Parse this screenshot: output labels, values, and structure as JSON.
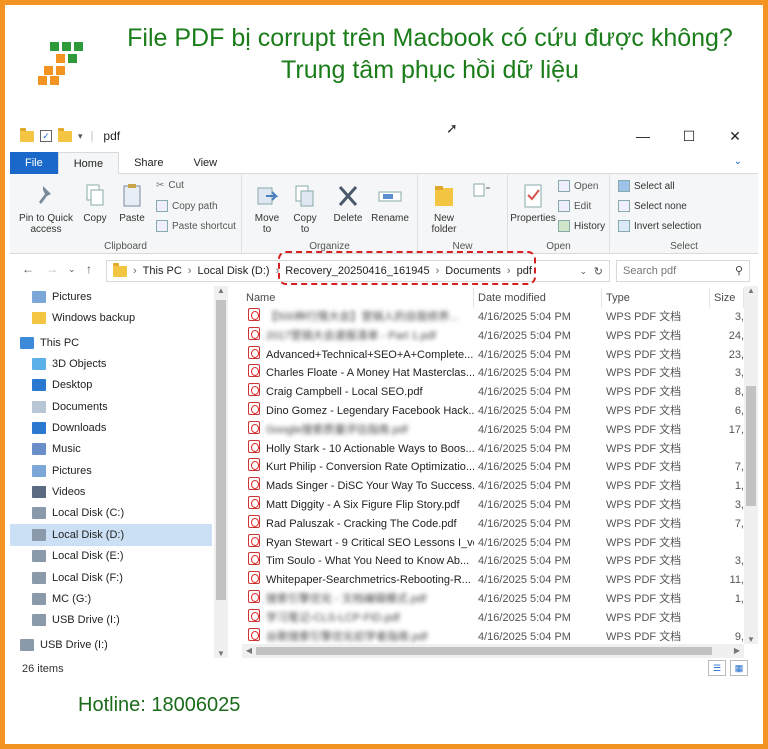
{
  "header": {
    "title": "File PDF bị corrupt trên Macbook có cứu được không? Trung tâm phục hồi dữ liệu",
    "hotline": "Hotline: 18006025"
  },
  "window": {
    "title": "pdf",
    "tabs": [
      "File",
      "Home",
      "Share",
      "View"
    ],
    "active_tab": "Home"
  },
  "ribbon": {
    "clipboard": {
      "group": "Clipboard",
      "pin": "Pin to Quick access",
      "copy": "Copy",
      "paste": "Paste",
      "cut": "Cut",
      "copy_path": "Copy path",
      "paste_shortcut": "Paste shortcut"
    },
    "organize": {
      "group": "Organize",
      "move_to": "Move to",
      "copy_to": "Copy to",
      "delete": "Delete",
      "rename": "Rename"
    },
    "new": {
      "group": "New",
      "new_folder": "New folder"
    },
    "open": {
      "group": "Open",
      "properties": "Properties",
      "open": "Open",
      "edit": "Edit",
      "history": "History"
    },
    "select": {
      "group": "Select",
      "select_all": "Select all",
      "select_none": "Select none",
      "invert": "Invert selection"
    }
  },
  "address": {
    "crumbs": [
      "This PC",
      "Local Disk (D:)",
      "Recovery_20250416_161945",
      "Documents",
      "pdf"
    ],
    "search_placeholder": "Search pdf"
  },
  "nav": [
    {
      "label": "Pictures",
      "icon": "pictures-icon"
    },
    {
      "label": "Windows backup",
      "icon": "folder-icon"
    },
    {
      "label": "This PC",
      "icon": "pc-icon"
    },
    {
      "label": "3D Objects",
      "icon": "objects-icon"
    },
    {
      "label": "Desktop",
      "icon": "desktop-icon"
    },
    {
      "label": "Documents",
      "icon": "documents-icon"
    },
    {
      "label": "Downloads",
      "icon": "downloads-icon"
    },
    {
      "label": "Music",
      "icon": "music-icon"
    },
    {
      "label": "Pictures",
      "icon": "pictures-icon"
    },
    {
      "label": "Videos",
      "icon": "videos-icon"
    },
    {
      "label": "Local Disk (C:)",
      "icon": "drive-icon"
    },
    {
      "label": "Local Disk (D:)",
      "icon": "drive-icon",
      "selected": true
    },
    {
      "label": "Local Disk (E:)",
      "icon": "drive-icon"
    },
    {
      "label": "Local Disk (F:)",
      "icon": "drive-icon"
    },
    {
      "label": "MC (G:)",
      "icon": "drive-icon"
    },
    {
      "label": "USB Drive (I:)",
      "icon": "drive-icon"
    },
    {
      "label": "USB Drive (I:)",
      "icon": "drive-icon"
    }
  ],
  "columns": [
    "Name",
    "Date modified",
    "Type",
    "Size"
  ],
  "files": [
    {
      "name": "【500种行情大会】营销人的自我修养...",
      "blur": true,
      "date": "4/16/2025 5:04 PM",
      "type": "WPS PDF 文档",
      "size": "3,"
    },
    {
      "name": "2017营销大会速报清单 - Part 1.pdf",
      "blur": true,
      "date": "4/16/2025 5:04 PM",
      "type": "WPS PDF 文档",
      "size": "24,"
    },
    {
      "name": "Advanced+Technical+SEO+A+Complete...",
      "date": "4/16/2025 5:04 PM",
      "type": "WPS PDF 文档",
      "size": "23,"
    },
    {
      "name": "Charles Floate - A Money Hat Masterclas...",
      "date": "4/16/2025 5:04 PM",
      "type": "WPS PDF 文档",
      "size": "3,"
    },
    {
      "name": "Craig Campbell - Local SEO.pdf",
      "date": "4/16/2025 5:04 PM",
      "type": "WPS PDF 文档",
      "size": "8,"
    },
    {
      "name": "Dino Gomez - Legendary Facebook Hack...",
      "date": "4/16/2025 5:04 PM",
      "type": "WPS PDF 文档",
      "size": "6,"
    },
    {
      "name": "Google搜索质量评估指南.pdf",
      "blur": true,
      "date": "4/16/2025 5:04 PM",
      "type": "WPS PDF 文档",
      "size": "17,"
    },
    {
      "name": "Holly Stark - 10 Actionable Ways to Boos...",
      "date": "4/16/2025 5:04 PM",
      "type": "WPS PDF 文档",
      "size": ""
    },
    {
      "name": "Kurt Philip - Conversion Rate Optimizatio...",
      "date": "4/16/2025 5:04 PM",
      "type": "WPS PDF 文档",
      "size": "7,"
    },
    {
      "name": "Mads Singer - DiSC Your Way To Success...",
      "date": "4/16/2025 5:04 PM",
      "type": "WPS PDF 文档",
      "size": "1,"
    },
    {
      "name": "Matt Diggity - A Six Figure Flip Story.pdf",
      "date": "4/16/2025 5:04 PM",
      "type": "WPS PDF 文档",
      "size": "3,"
    },
    {
      "name": "Rad Paluszak - Cracking The Code.pdf",
      "date": "4/16/2025 5:04 PM",
      "type": "WPS PDF 文档",
      "size": "7,"
    },
    {
      "name": "Ryan Stewart - 9 Critical SEO Lessons I_ve...",
      "date": "4/16/2025 5:04 PM",
      "type": "WPS PDF 文档",
      "size": ""
    },
    {
      "name": "Tim Soulo - What You Need to Know Ab...",
      "date": "4/16/2025 5:04 PM",
      "type": "WPS PDF 文档",
      "size": "3,"
    },
    {
      "name": "Whitepaper-Searchmetrics-Rebooting-R...",
      "date": "4/16/2025 5:04 PM",
      "type": "WPS PDF 文档",
      "size": "11,"
    },
    {
      "name": "搜索引擎优化 - 文档编辑模式.pdf",
      "blur": true,
      "date": "4/16/2025 5:04 PM",
      "type": "WPS PDF 文档",
      "size": "1,"
    },
    {
      "name": "学习笔记-CLS-LCP-FID.pdf",
      "blur": true,
      "date": "4/16/2025 5:04 PM",
      "type": "WPS PDF 文档",
      "size": ""
    },
    {
      "name": "谷歌搜索引擎优化初学者指南.pdf",
      "blur": true,
      "date": "4/16/2025 5:04 PM",
      "type": "WPS PDF 文档",
      "size": "9,"
    }
  ],
  "status": {
    "count": "26 items"
  },
  "colors": {
    "frame": "#f39422",
    "title": "#1a7d1a",
    "accent": "#1a68c9",
    "highlight": "#d62020"
  }
}
